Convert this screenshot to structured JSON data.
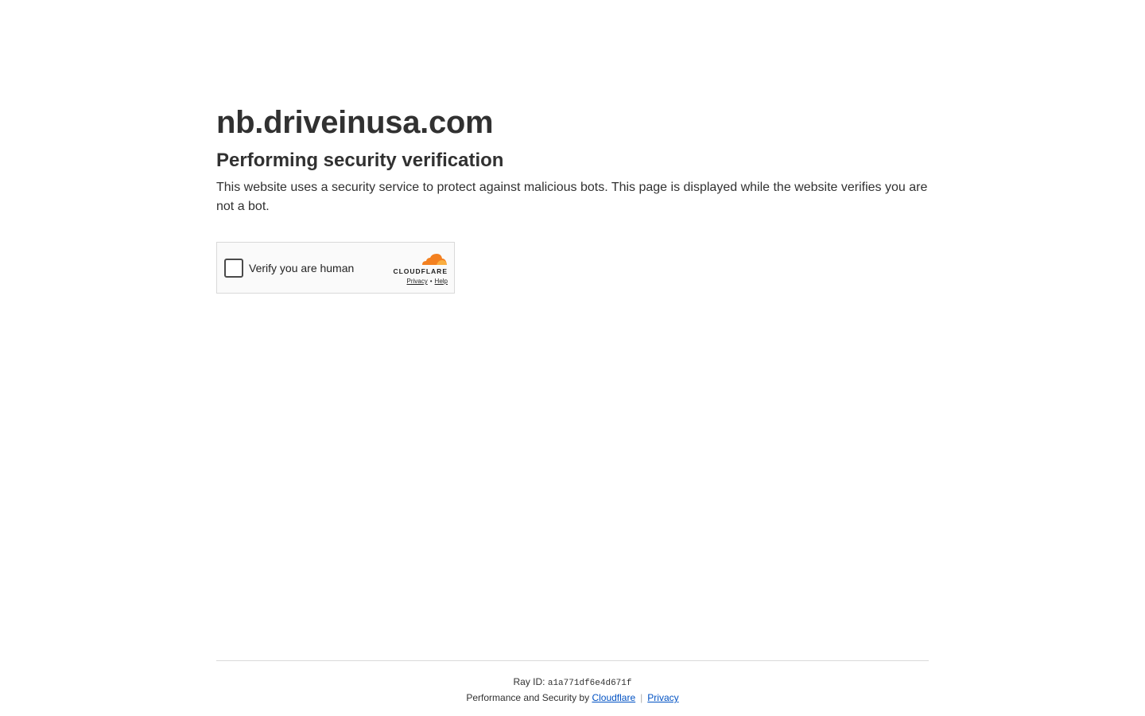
{
  "header": {
    "site_title": "nb.driveinusa.com",
    "subtitle": "Performing security verification",
    "description": "This website uses a security service to protect against malicious bots. This page is displayed while the website verifies you are not a bot."
  },
  "widget": {
    "checkbox_label": "Verify you are human",
    "brand_wordmark": "CLOUDFLARE",
    "privacy_link": "Privacy",
    "link_separator": "•",
    "help_link": "Help",
    "brand_colors": {
      "orange_dark": "#f38020",
      "orange_light": "#faae40"
    }
  },
  "footer": {
    "ray_label": "Ray ID:",
    "ray_id": "a1a771df6e4d671f",
    "performance_text": "Performance and Security by",
    "cloudflare_link": "Cloudflare",
    "separator": "|",
    "privacy_link": "Privacy"
  }
}
